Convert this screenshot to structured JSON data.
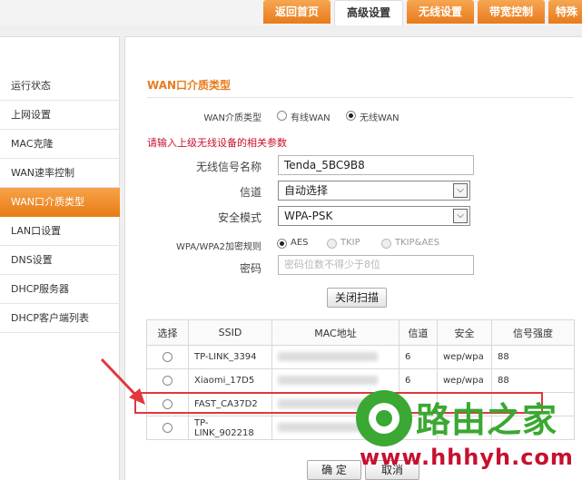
{
  "nav": {
    "tabs": [
      "返回首页",
      "高级设置",
      "无线设置",
      "带宽控制",
      "特殊"
    ]
  },
  "sidebar": {
    "items": [
      "运行状态",
      "上网设置",
      "MAC克隆",
      "WAN速率控制",
      "WAN口介质类型",
      "LAN口设置",
      "DNS设置",
      "DHCP服务器",
      "DHCP客户端列表"
    ],
    "active_index": 4
  },
  "main": {
    "section_title": "WAN口介质类型",
    "media_type": {
      "label": "WAN介质类型",
      "options": [
        "有线WAN",
        "无线WAN"
      ],
      "selected": "无线WAN"
    },
    "hint": "请输入上级无线设备的相关参数",
    "ssid": {
      "label": "无线信号名称",
      "value": "Tenda_5BC9B8"
    },
    "channel": {
      "label": "信道",
      "value": "自动选择"
    },
    "security_mode": {
      "label": "安全模式",
      "value": "WPA-PSK"
    },
    "encryption": {
      "label": "WPA/WPA2加密规则",
      "options": [
        "AES",
        "TKIP",
        "TKIP&AES"
      ],
      "selected": "AES"
    },
    "password": {
      "label": "密码",
      "placeholder": "密码位数不得少于8位"
    },
    "scan_button": "关闭扫描",
    "table": {
      "headers": [
        "选择",
        "SSID",
        "MAC地址",
        "信道",
        "安全",
        "信号强度"
      ],
      "rows": [
        {
          "ssid": "TP-LINK_3394",
          "channel": "6",
          "security": "wep/wpa",
          "signal": "88"
        },
        {
          "ssid": "Xiaomi_17D5",
          "channel": "6",
          "security": "wep/wpa",
          "signal": "88"
        },
        {
          "ssid": "FAST_CA37D2",
          "channel": "",
          "security": "",
          "signal": ""
        },
        {
          "ssid": "TP-LINK_902218",
          "channel": "",
          "security": "",
          "signal": ""
        }
      ]
    },
    "ok_button": "确 定",
    "cancel_button": "取消"
  },
  "watermark": {
    "text": "路由之家",
    "url": "www.hhhyh.com"
  },
  "colors": {
    "accent": "#e87b1c",
    "hint_red": "#c8102e",
    "highlight_red": "#e0383c",
    "watermark_green": "#3aa832"
  }
}
